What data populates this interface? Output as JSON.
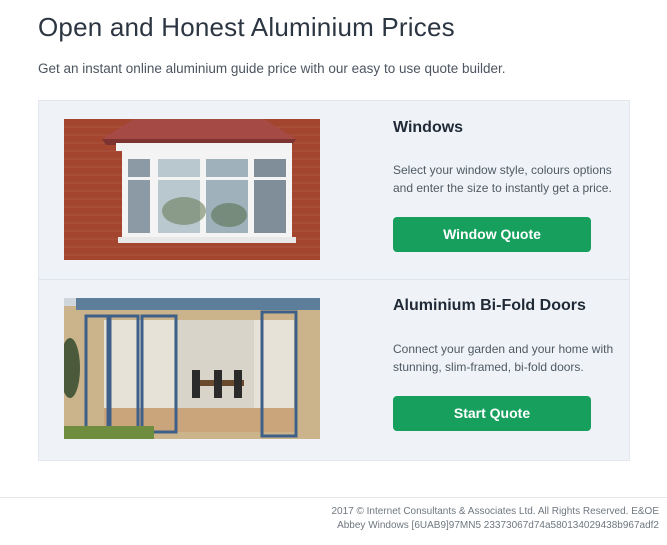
{
  "header": {
    "title": "Open and Honest Aluminium Prices",
    "subtitle": "Get an instant online aluminium guide price with our easy to use quote builder."
  },
  "products": [
    {
      "heading": "Windows",
      "description": "Select your window style, colours options and enter the size to instantly get a price.",
      "button_label": "Window Quote",
      "image": "bay-window-photo"
    },
    {
      "heading": "Aluminium Bi-Fold Doors",
      "description": "Connect your garden and your home with stunning, slim-framed, bi-fold doors.",
      "button_label": "Start Quote",
      "image": "bifold-doors-photo"
    }
  ],
  "footer": {
    "copyright": "2017 © Internet Consultants & Associates Ltd. All Rights Reserved. E&OE",
    "id_line": "Abbey Windows [6UAB9]97MN5 23373067d74a580134029438b967adf2"
  },
  "colors": {
    "accent_button": "#17a05d",
    "panel_bg": "#eff3f7"
  }
}
